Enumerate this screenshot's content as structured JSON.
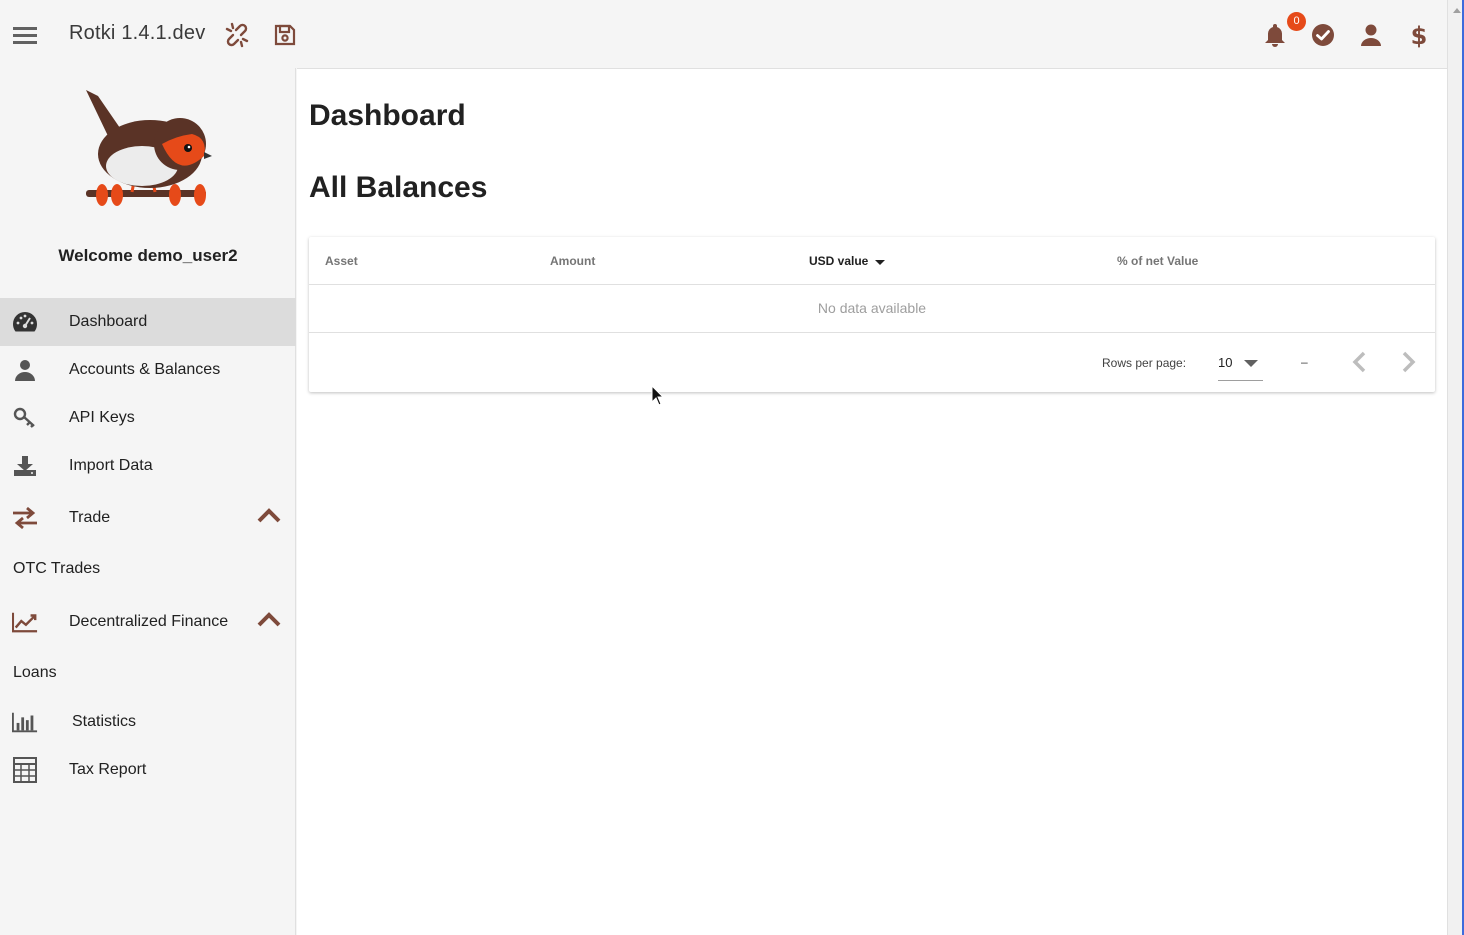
{
  "colors": {
    "accent": "#7e4a3b",
    "badge": "#e64a19",
    "active_nav_bg": "#dcdcdc"
  },
  "topbar": {
    "title": "Rotki 1.4.1.dev",
    "notification_count": "0",
    "icons": [
      "menu-icon",
      "disconnected-icon",
      "save-icon",
      "bell-icon",
      "check-circle-icon",
      "user-icon",
      "dollar-icon"
    ]
  },
  "sidebar": {
    "welcome": "Welcome demo_user2",
    "items": [
      {
        "label": "Dashboard",
        "icon": "tachometer-icon",
        "active": true
      },
      {
        "label": "Accounts & Balances",
        "icon": "user-icon"
      },
      {
        "label": "API Keys",
        "icon": "key-icon"
      },
      {
        "label": "Import Data",
        "icon": "download-icon"
      },
      {
        "label": "Trade",
        "icon": "exchange-icon",
        "expanded": true
      },
      {
        "label": "OTC Trades"
      },
      {
        "label": "Decentralized Finance",
        "icon": "line-chart-icon",
        "expanded": true
      },
      {
        "label": "Loans"
      },
      {
        "label": "Statistics",
        "icon": "bar-chart-icon"
      },
      {
        "label": "Tax Report",
        "icon": "calculator-icon"
      }
    ]
  },
  "main": {
    "page_title": "Dashboard",
    "section_title": "All Balances",
    "table": {
      "headers": [
        "Asset",
        "Amount",
        "USD value",
        "% of net Value"
      ],
      "sorted_column": "USD value",
      "empty_text": "No data available",
      "rows_per_page_label": "Rows per page:",
      "rows_per_page_value": "10",
      "range_text": "–"
    }
  }
}
